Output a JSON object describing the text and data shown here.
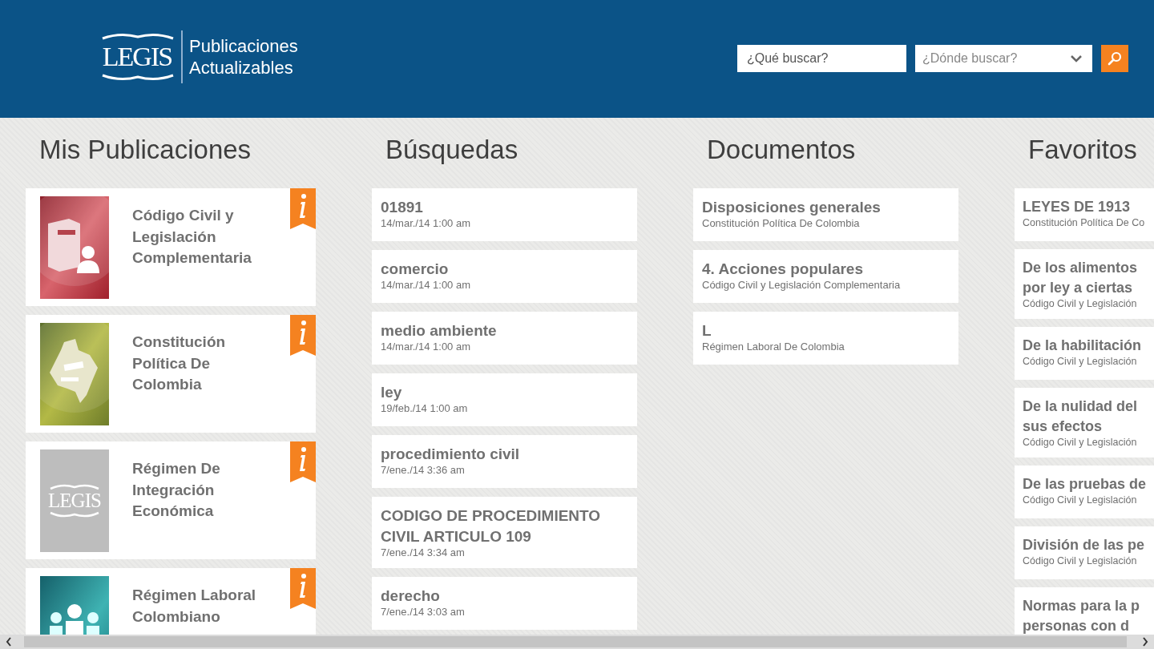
{
  "header": {
    "logo": {
      "mark": "LEGIS",
      "title_lines": [
        "Publicaciones",
        "Actualizables"
      ]
    },
    "search": {
      "query_placeholder": "¿Qué buscar?",
      "scope_placeholder": "¿Dónde buscar?"
    }
  },
  "sections": [
    {
      "kind": "publications",
      "title": "Mis Publicaciones",
      "items": [
        {
          "title": "Código Civil y Legislación Complementaria",
          "cover": {
            "kind": "book"
          }
        },
        {
          "title": "Constitución Política De Colombia",
          "cover": {
            "kind": "map"
          }
        },
        {
          "title": "Régimen De Integración Económica",
          "cover": {
            "kind": "logo",
            "text": "LEGIS"
          }
        },
        {
          "title": "Régimen Laboral Colombiano",
          "cover": {
            "kind": "people"
          }
        }
      ]
    },
    {
      "kind": "list",
      "title": "Búsquedas",
      "items": [
        {
          "lines": [
            "01891"
          ],
          "subtitle": "14/mar./14 1:00 am"
        },
        {
          "lines": [
            "comercio"
          ],
          "subtitle": "14/mar./14 1:00 am"
        },
        {
          "lines": [
            "medio ambiente"
          ],
          "subtitle": "14/mar./14 1:00 am"
        },
        {
          "lines": [
            "ley"
          ],
          "subtitle": "19/feb./14 1:00 am"
        },
        {
          "lines": [
            "procedimiento civil"
          ],
          "subtitle": "7/ene./14 3:36 am"
        },
        {
          "lines": [
            "CODIGO DE PROCEDIMIENTO",
            "CIVIL ARTICULO 109"
          ],
          "subtitle": "7/ene./14 3:34 am"
        },
        {
          "lines": [
            "derecho"
          ],
          "subtitle": "7/ene./14 3:03 am"
        }
      ]
    },
    {
      "kind": "list",
      "title": "Documentos",
      "items": [
        {
          "lines": [
            "Disposiciones generales"
          ],
          "subtitle": "Constitución Política De Colombia"
        },
        {
          "lines": [
            "4. Acciones populares"
          ],
          "subtitle": "Código Civil y Legislación Complementaria"
        },
        {
          "lines": [
            "L"
          ],
          "subtitle": "Régimen Laboral De Colombia"
        }
      ]
    },
    {
      "kind": "list",
      "title": "Favoritos",
      "items": [
        {
          "lines": [
            "LEYES DE 1913"
          ],
          "subtitle": "Constitución Política De Co"
        },
        {
          "lines": [
            "De los alimentos",
            "por ley a ciertas"
          ],
          "subtitle": "Código Civil y Legislación"
        },
        {
          "lines": [
            "De la habilitación"
          ],
          "subtitle": "Código Civil y Legislación"
        },
        {
          "lines": [
            "De la nulidad del",
            "sus efectos"
          ],
          "subtitle": "Código Civil y Legislación"
        },
        {
          "lines": [
            "De las pruebas de"
          ],
          "subtitle": "Código Civil y Legislación"
        },
        {
          "lines": [
            "División de las pe"
          ],
          "subtitle": "Código Civil y Legislación"
        },
        {
          "lines": [
            "Normas para la p",
            "personas con d"
          ]
        }
      ]
    }
  ]
}
